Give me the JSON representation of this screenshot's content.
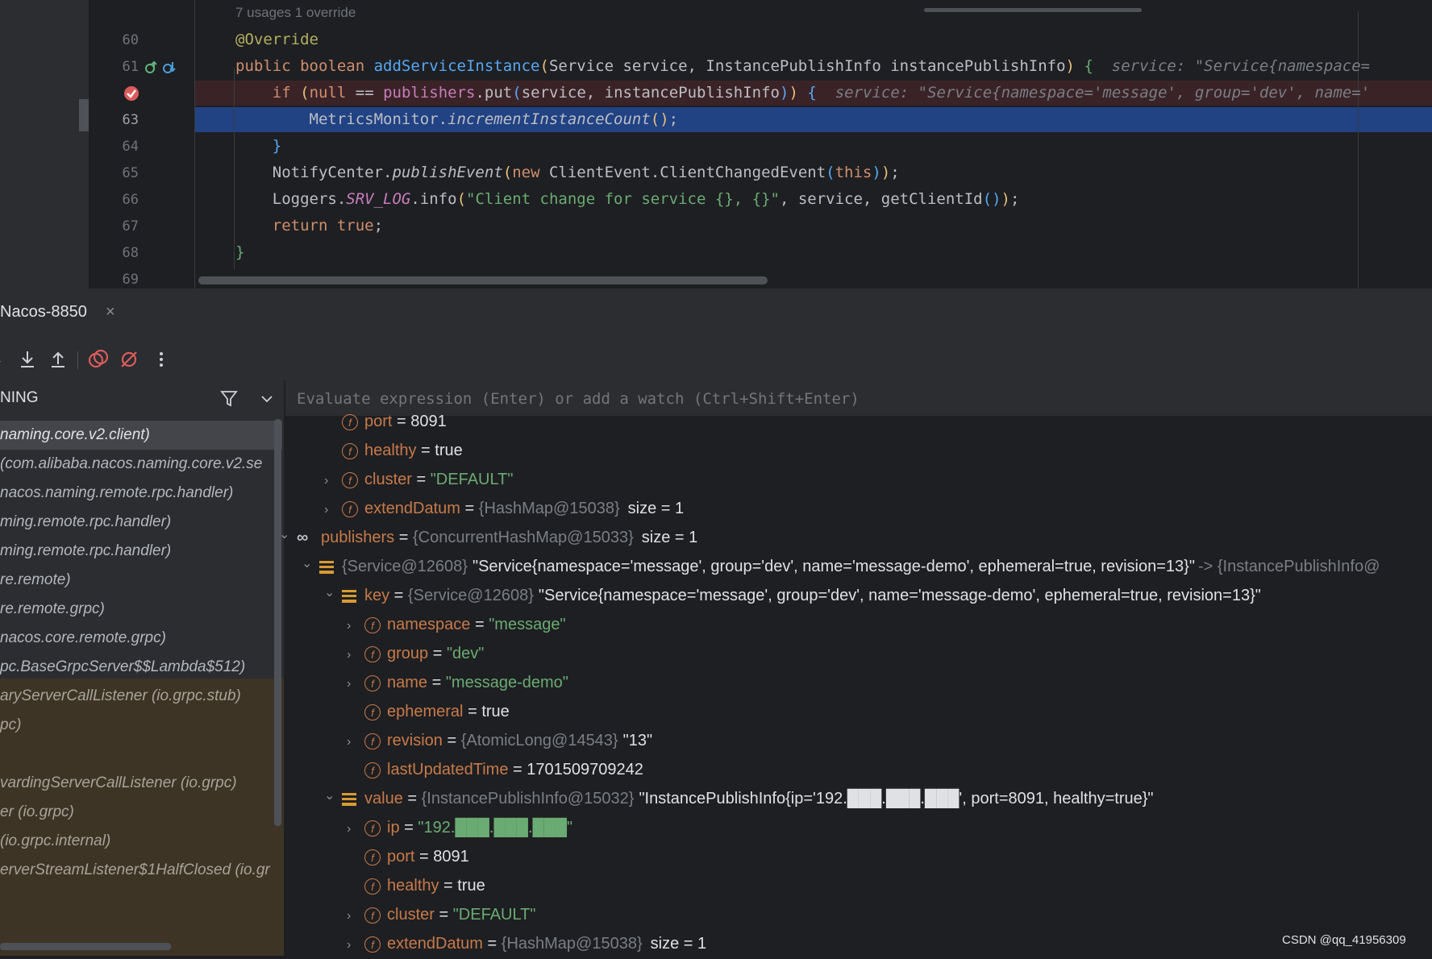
{
  "editor": {
    "usages_hint": "7 usages   1 override",
    "lines": [
      {
        "num": "60"
      },
      {
        "num": "61"
      },
      {
        "num": ""
      },
      {
        "num": "63"
      },
      {
        "num": "64"
      },
      {
        "num": "65"
      },
      {
        "num": "66"
      },
      {
        "num": "67"
      },
      {
        "num": "68"
      },
      {
        "num": "69"
      }
    ],
    "code": {
      "l60_annotation": "@Override",
      "l61_public": "public",
      "l61_boolean": " boolean ",
      "l61_method": "addServiceInstance",
      "l61_params": "Service service, InstancePublishInfo instancePublishInfo",
      "l61_hint": "service: \"Service{namespace=",
      "l62_if": "if",
      "l62_null": "null",
      "l62_eq": " == ",
      "l62_publishers": "publishers",
      "l62_put": ".put",
      "l62_args": "service, instancePublishInfo",
      "l62_hint": "service: \"Service{namespace='message', group='dev', name='",
      "l63_class": "MetricsMonitor.",
      "l63_method": "incrementInstanceCount",
      "l63_tail": ";",
      "l64_brace": "}",
      "l65_class": "NotifyCenter.",
      "l65_method": "publishEvent",
      "l65_new": "new",
      "l65_type": " ClientEvent.ClientChangedEvent",
      "l65_this": "this",
      "l65_tail": ";",
      "l66_class": "Loggers.",
      "l66_field": "SRV_LOG",
      "l66_info": ".info",
      "l66_str": "\"Client change for service {}, {}\"",
      "l66_args": ", service, getClientId",
      "l66_tail": ";",
      "l67_return": "return",
      "l67_true": "true",
      "l67_tail": ";",
      "l68_brace": "}"
    }
  },
  "debug": {
    "tab_title": "Nacos-8850",
    "tab_close": "×",
    "frames_title": "NING",
    "eval_placeholder": "Evaluate expression (Enter) or add a watch (Ctrl+Shift+Enter)",
    "frames": [
      "naming.core.v2.client)",
      "(com.alibaba.nacos.naming.core.v2.se",
      "nacos.naming.remote.rpc.handler)",
      "ming.remote.rpc.handler)",
      "ming.remote.rpc.handler)",
      "re.remote)",
      "re.remote.grpc)",
      "nacos.core.remote.grpc)",
      "pc.BaseGrpcServer$$Lambda$512)",
      "aryServerCallListener (io.grpc.stub)",
      "pc)",
      "",
      "vardingServerCallListener (io.grpc)",
      "er (io.grpc)",
      "(io.grpc.internal)",
      "erverStreamListener$1HalfClosed (io.gr"
    ],
    "variables": [
      {
        "name": "port",
        "eq": " = ",
        "ref": "",
        "value": "8091",
        "size": ""
      },
      {
        "name": "healthy",
        "eq": " = ",
        "ref": "",
        "value": "true",
        "size": ""
      },
      {
        "name": "cluster",
        "eq": " = ",
        "ref": "",
        "value": "\"DEFAULT\"",
        "size": ""
      },
      {
        "name": "extendDatum",
        "eq": " = ",
        "ref": "{HashMap@15038}",
        "value": "",
        "size": "size = 1"
      },
      {
        "name": "publishers",
        "eq": " = ",
        "ref": "{ConcurrentHashMap@15033}",
        "value": "",
        "size": "size = 1"
      },
      {
        "name": "",
        "eq": "",
        "ref": "{Service@12608}",
        "value": "\"Service{namespace='message', group='dev', name='message-demo', ephemeral=true, revision=13}\"",
        "size": "-> {InstancePublishInfo@"
      },
      {
        "name": "key",
        "eq": " = ",
        "ref": "{Service@12608}",
        "value": "\"Service{namespace='message', group='dev', name='message-demo', ephemeral=true, revision=13}\"",
        "size": ""
      },
      {
        "name": "namespace",
        "eq": " = ",
        "ref": "",
        "value": "\"message\"",
        "size": ""
      },
      {
        "name": "group",
        "eq": " = ",
        "ref": "",
        "value": "\"dev\"",
        "size": ""
      },
      {
        "name": "name",
        "eq": " = ",
        "ref": "",
        "value": "\"message-demo\"",
        "size": ""
      },
      {
        "name": "ephemeral",
        "eq": " = ",
        "ref": "",
        "value": "true",
        "size": ""
      },
      {
        "name": "revision",
        "eq": " = ",
        "ref": "{AtomicLong@14543}",
        "value": "\"13\"",
        "size": ""
      },
      {
        "name": "lastUpdatedTime",
        "eq": " = ",
        "ref": "",
        "value": "1701509709242",
        "size": ""
      },
      {
        "name": "value",
        "eq": " = ",
        "ref": "{InstancePublishInfo@15032}",
        "value": "\"InstancePublishInfo{ip='192.███.███.███', port=8091, healthy=true}\"",
        "size": ""
      },
      {
        "name": "ip",
        "eq": " = ",
        "ref": "",
        "value": "\"192.███.███.███\"",
        "size": ""
      },
      {
        "name": "port",
        "eq": " = ",
        "ref": "",
        "value": "8091",
        "size": ""
      },
      {
        "name": "healthy",
        "eq": " = ",
        "ref": "",
        "value": "true",
        "size": ""
      },
      {
        "name": "cluster",
        "eq": " = ",
        "ref": "",
        "value": "\"DEFAULT\"",
        "size": ""
      },
      {
        "name": "extendDatum",
        "eq": " = ",
        "ref": "{HashMap@15038}",
        "value": "",
        "size": "size = 1"
      }
    ]
  },
  "watermark": "CSDN @qq_41956309",
  "colors": {
    "editor_bg": "#1e1f22",
    "panel_bg": "#2b2d30",
    "current_line": "#214283",
    "breakpoint_line": "#3a2327",
    "breakpoint": "#db5c5c",
    "field_icon": "#c77a4a",
    "string": "#6aab73",
    "keyword": "#cf8e6d",
    "method": "#56a8f5"
  }
}
